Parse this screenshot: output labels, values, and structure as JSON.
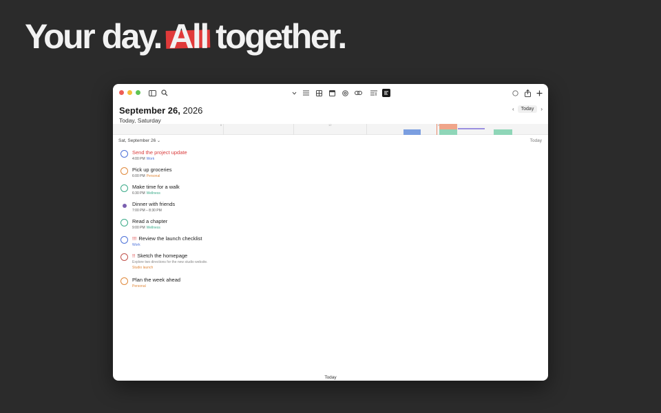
{
  "headline": {
    "before": "Your day. ",
    "highlight": "All",
    "after": " together.",
    "highlight_color": "#e03a3a"
  },
  "window": {
    "title_main": "September 26,",
    "title_year": " 2026",
    "subtitle": "Today, Saturday",
    "nav": {
      "prev_icon": "chevron-left-icon",
      "today_label": "Today",
      "next_icon": "chevron-right-icon"
    },
    "timeline": {
      "labels": [
        "6",
        "12",
        "6"
      ],
      "blocks": [
        {
          "color": "#7b9ee0"
        },
        {
          "color": "#f0a58a"
        },
        {
          "color": "#8fd6b8"
        },
        {
          "color": "#9a8fe0"
        },
        {
          "color": "#8fd6b8"
        }
      ]
    },
    "section": {
      "label": "Sat, September 26",
      "chevron": "⌄",
      "right_label": "Today"
    },
    "tasks": [
      {
        "title": "Send the project update",
        "priority": "",
        "time": "4:00 PM",
        "tag": "Work",
        "tag_color": "#4a6fd8",
        "circle_color": "#4a6fd8",
        "title_color": "#d93a3a",
        "note": ""
      },
      {
        "title": "Pick up groceries",
        "priority": "",
        "time": "6:00 PM",
        "tag": "Personal",
        "tag_color": "#e0883a",
        "circle_color": "#e0883a",
        "title_color": "#1a1a1a",
        "note": ""
      },
      {
        "title": "Make time for a walk",
        "priority": "",
        "time": "6:30 PM",
        "tag": "Wellness",
        "tag_color": "#3aaa88",
        "circle_color": "#3aaa88",
        "title_color": "#1a1a1a",
        "note": ""
      },
      {
        "title": "Dinner with friends",
        "priority": "",
        "time": "7:00 PM – 8:30 PM",
        "tag": "",
        "tag_color": "#555555",
        "circle_color": "#7b5fb0",
        "title_color": "#1a1a1a",
        "note": "",
        "is_event": true
      },
      {
        "title": "Read a chapter",
        "priority": "",
        "time": "9:00 PM",
        "tag": "Wellness",
        "tag_color": "#3aaa88",
        "circle_color": "#3aaa88",
        "title_color": "#1a1a1a",
        "note": ""
      },
      {
        "title": "Review the launch checklist",
        "priority": "!!!",
        "time": "",
        "tag": "Work",
        "tag_color": "#4a6fd8",
        "circle_color": "#4a6fd8",
        "title_color": "#1a1a1a",
        "note": ""
      },
      {
        "title": "Sketch the homepage",
        "priority": "!!",
        "time": "",
        "tag": "Studio launch",
        "tag_color": "#e0883a",
        "circle_color": "#c0504a",
        "title_color": "#1a1a1a",
        "note": "Explore two directions for the new studio website."
      },
      {
        "title": "Plan the week ahead",
        "priority": "",
        "time": "",
        "tag": "Personal",
        "tag_color": "#e0883a",
        "circle_color": "#e0883a",
        "title_color": "#1a1a1a",
        "note": ""
      }
    ],
    "bottom_label": "Today"
  },
  "toolbar_icons": [
    "sidebar-icon",
    "search-icon",
    "chevron-down-icon",
    "list-icon",
    "grid-icon",
    "calendar-icon",
    "at-sign-icon",
    "link-icon",
    "text-icon",
    "timeline-icon",
    "circle-icon",
    "share-icon",
    "plus-icon"
  ]
}
